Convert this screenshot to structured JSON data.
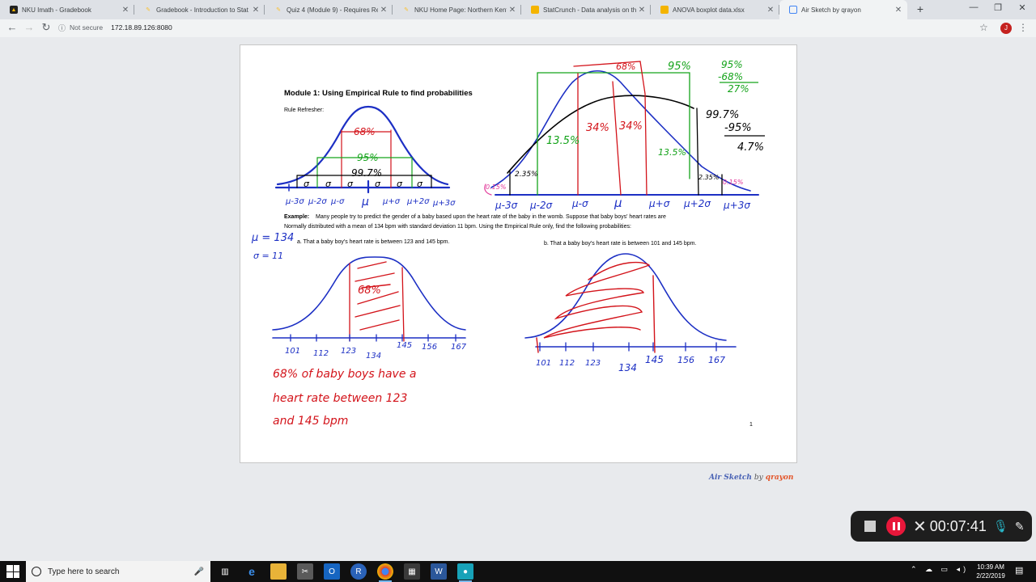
{
  "browser": {
    "tabs": [
      {
        "title": "NKU Imath - Gradebook",
        "favicon_color": "#f4b400",
        "active": false
      },
      {
        "title": "Gradebook - Introduction to Stat",
        "favicon_color": "#fdd835",
        "active": false
      },
      {
        "title": "Quiz 4 (Module 9) - Requires Re",
        "favicon_color": "#fdd835",
        "active": false
      },
      {
        "title": "NKU Home Page: Northern Kent",
        "favicon_color": "#fdd835",
        "active": false
      },
      {
        "title": "StatCrunch - Data analysis on the",
        "favicon_color": "#f4b400",
        "active": false
      },
      {
        "title": "ANOVA boxplot data.xlsx",
        "favicon_color": "#f4b400",
        "active": false
      },
      {
        "title": "Air Sketch by qrayon",
        "favicon_color": "#4285f4",
        "active": true
      }
    ],
    "security_label": "Not secure",
    "url": "172.18.89.126:8080",
    "profile_initial": "J"
  },
  "document": {
    "title": "Module 1:  Using Empirical Rule to find probabilities",
    "subtitle": "Rule Refresher:",
    "example_label": "Example:",
    "example_text_1": "Many people try to predict the gender of a baby based upon the heart rate of the baby in the womb.  Suppose that baby boys' heart rates are",
    "example_text_2": "Normally distributed with a mean of 134 bpm with standard deviation 11 bpm.  Using the Empirical Rule only, find the following probabilities:",
    "part_a": "a.    That a baby boy's heart rate is between 123 and 145 bpm.",
    "part_b": "b.    That a baby boy's heart rate is between 101 and 145 bpm.",
    "page_number": "1",
    "annotations": {
      "rule_68": "68%",
      "rule_95": "95%",
      "rule_997": "99.7%",
      "sigma": "σ",
      "left_axis": [
        "μ-3σ",
        "μ-2σ",
        "μ-σ",
        "μ",
        "μ+σ",
        "μ+2σ",
        "μ+3σ"
      ],
      "big_68": "68%",
      "big_95": "95%",
      "big_34a": "34%",
      "big_34b": "34%",
      "big_135a": "13.5%",
      "big_135b": "13.5%",
      "big_235a": "2.35%",
      "big_235b": "2.35%",
      "big_015a": "0.15%",
      "big_015b": "0.15%",
      "calc_a1": "95%",
      "calc_a2": "-68%",
      "calc_a3": "27%",
      "calc_b1": "99.7%",
      "calc_b2": "-95%",
      "calc_b3": "4.7%",
      "mu_value": "μ = 134",
      "sigma_value": "σ = 11",
      "shade_a": "68%",
      "axis_values": [
        "101",
        "112",
        "123",
        "134",
        "145",
        "156",
        "167"
      ],
      "answer_line1": "68% of baby boys have a",
      "answer_line2": "heart rate between 123",
      "answer_line3": "and 145 bpm"
    }
  },
  "branding": {
    "name": "Air Sketch",
    "by": "by",
    "maker": "qrayon"
  },
  "recorder": {
    "elapsed": "00:07:41"
  },
  "taskbar": {
    "search_placeholder": "Type here to search",
    "time": "10:39 AM",
    "date": "2/22/2019"
  },
  "colors": {
    "ink_blue": "#1c2fc4",
    "ink_red": "#d3131a",
    "ink_green": "#14a31a",
    "ink_black": "#000000",
    "ink_pink": "#e23a9a"
  }
}
